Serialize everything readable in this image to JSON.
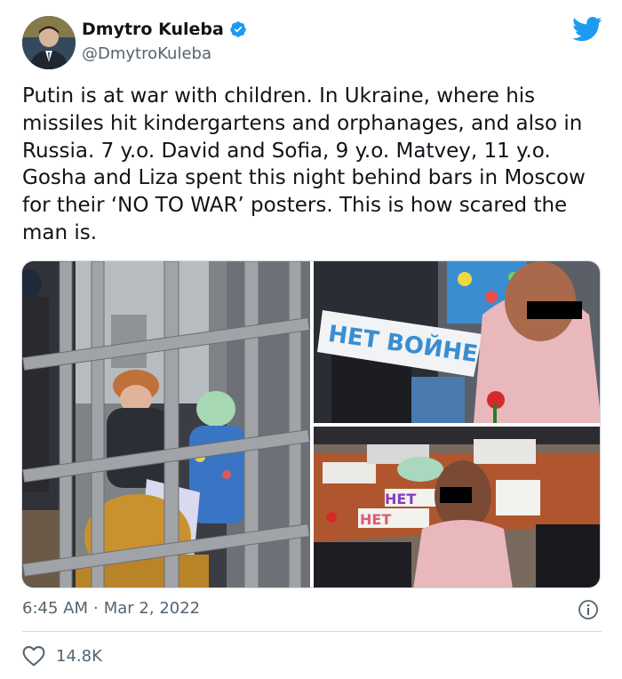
{
  "author": {
    "name": "Dmytro Kuleba",
    "handle": "@DmytroKuleba"
  },
  "tweet": {
    "text": "Putin is at war with children. In Ukraine, where his missiles hit kindergartens and orphanages, and also in Russia. 7 y.o. David and Sofia, 9 y.o. Matvey, 11 y.o. Gosha and Liza spent this night behind bars in Moscow for their ‘NO TO WAR’ posters. This is how scared the man is.",
    "time": "6:45 AM",
    "separator": "·",
    "date": "Mar 2, 2022",
    "likes": "14.8K"
  },
  "media": {
    "poster_text_1": "НЕТ ВОЙНЕ",
    "poster_text_2": "НЕТ",
    "poster_text_3": "НЕТ"
  },
  "icons": {
    "verified": "verified-badge-icon",
    "brand": "twitter-bird-icon",
    "info": "info-icon",
    "like": "heart-icon"
  },
  "colors": {
    "twitter_blue": "#1d9bf0",
    "text_primary": "#0f1419",
    "text_secondary": "#536471",
    "border": "#cfd9de"
  }
}
